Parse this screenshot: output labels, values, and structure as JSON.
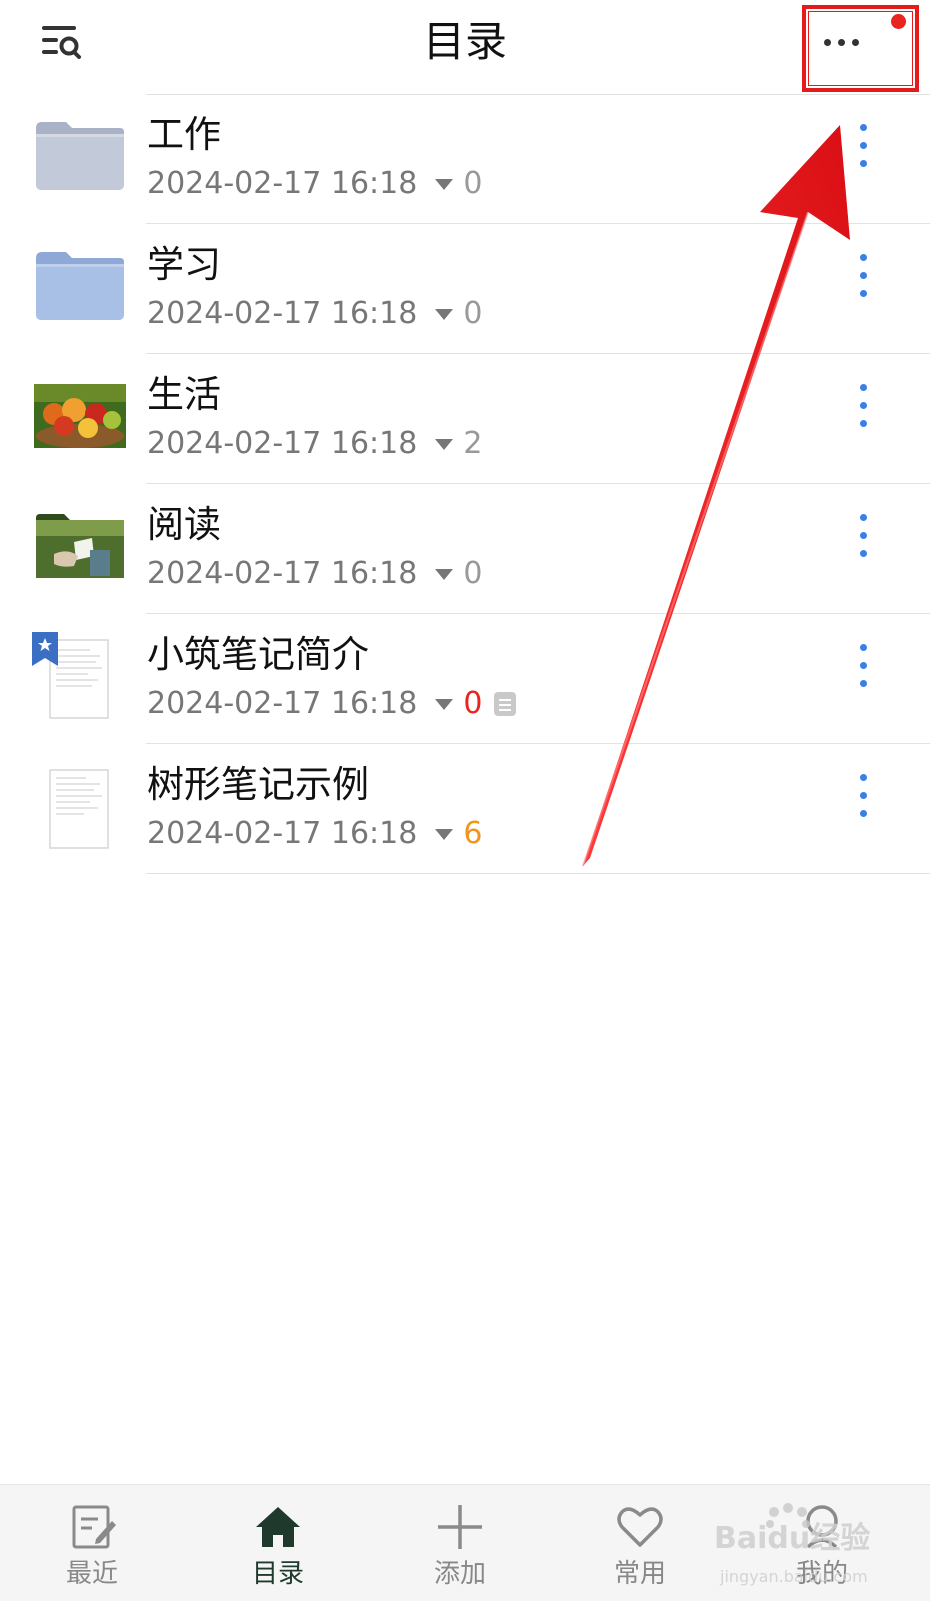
{
  "header": {
    "title": "目录",
    "menu_icon": "list-search-icon",
    "more_icon": "more-horizontal-icon",
    "badge_color": "#e8251f"
  },
  "items": [
    {
      "name": "工作",
      "date": "2024-02-17 16:18",
      "count": "0",
      "count_color": "gray",
      "thumb": "folder-icon-gray"
    },
    {
      "name": "学习",
      "date": "2024-02-17 16:18",
      "count": "0",
      "count_color": "gray",
      "thumb": "folder-icon-blue"
    },
    {
      "name": "生活",
      "date": "2024-02-17 16:18",
      "count": "2",
      "count_color": "gray",
      "thumb": "fruit-basket-photo"
    },
    {
      "name": "阅读",
      "date": "2024-02-17 16:18",
      "count": "0",
      "count_color": "gray",
      "thumb": "reading-photo"
    },
    {
      "name": "小筑笔记简介",
      "date": "2024-02-17 16:18",
      "count": "0",
      "count_color": "red",
      "thumb": "document-icon-bookmarked",
      "note_icon": true
    },
    {
      "name": "树形笔记示例",
      "date": "2024-02-17 16:18",
      "count": "6",
      "count_color": "orange",
      "thumb": "document-icon"
    }
  ],
  "tabbar": {
    "tabs": [
      {
        "label": "最近",
        "icon": "edit-note-icon",
        "active": false
      },
      {
        "label": "目录",
        "icon": "home-icon",
        "active": true
      },
      {
        "label": "添加",
        "icon": "plus-icon",
        "active": false
      },
      {
        "label": "常用",
        "icon": "heart-icon",
        "active": false
      },
      {
        "label": "我的",
        "icon": "person-icon",
        "active": false
      }
    ]
  },
  "annotation": {
    "highlight_color": "#e51b1b",
    "arrow_color": "#e8161b"
  },
  "watermark": {
    "brand": "Baidu经验",
    "url": "jingyan.baidu.com"
  }
}
